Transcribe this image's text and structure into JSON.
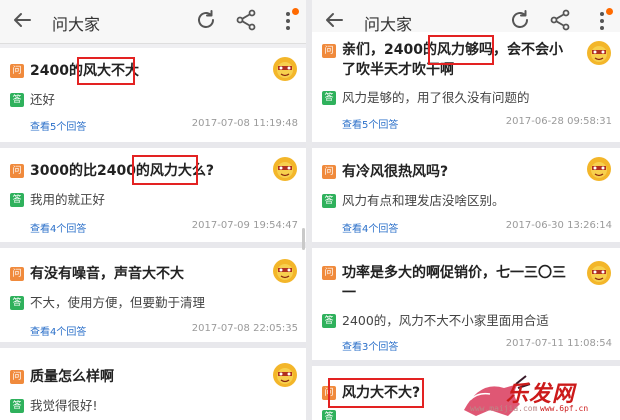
{
  "left": {
    "header": {
      "title": "问大家"
    },
    "cards": [
      {
        "question": "2400的风大不大",
        "answer": "还好",
        "link": "查看5个回答",
        "date": "2017-07-08 11:19:48"
      },
      {
        "question": "3000的比2400的风力大么?",
        "answer": "我用的就正好",
        "link": "查看4个回答",
        "date": "2017-07-09 19:54:47"
      },
      {
        "question": "有没有噪音，声音大不大",
        "answer": "不大，使用方便，但要勤于清理",
        "link": "查看4个回答",
        "date": "2017-07-08 22:05:35"
      },
      {
        "question": "质量怎么样啊",
        "answer": "我觉得很好!"
      }
    ]
  },
  "right": {
    "header": {
      "title": "问大家"
    },
    "cards": [
      {
        "question_line1": "亲们，2400的风力够吗，会不会小",
        "question_line2": "了吹半天才吹干啊",
        "answer": "风力是够的，用了很久没有问题的",
        "link": "查看5个回答",
        "date": "2017-06-28 09:58:31"
      },
      {
        "question": "有冷风很热风吗?",
        "answer": "风力有点和理发店没啥区别。",
        "link": "查看4个回答",
        "date": "2017-06-30 13:26:14"
      },
      {
        "question_line1": "功率是多大的啊促销价，七一三〇三",
        "question_line2": "一",
        "answer": "2400的，风力不大不小家里面用合适",
        "link": "查看3个回答",
        "date": "2017-07-11 11:08:54"
      },
      {
        "question": "风力大不大?"
      }
    ]
  },
  "badges": {
    "question": "问",
    "answer": "答"
  },
  "watermark": {
    "brand": "乐发网",
    "site": "www.6pf.cn",
    "site2": "www.maijia.com"
  },
  "colors": {
    "highlight": "#e32222",
    "question_badge": "#f08a3c",
    "answer_badge": "#2fb15c",
    "link": "#2a6fc9",
    "notify_dot": "#ff6a00"
  }
}
